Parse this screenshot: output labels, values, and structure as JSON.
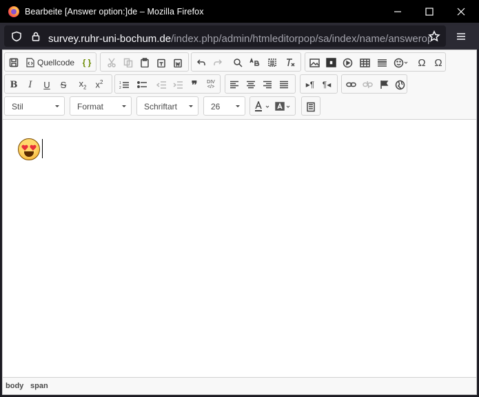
{
  "window": {
    "title": "Bearbeite [Answer option:]de – Mozilla Firefox"
  },
  "url": {
    "host": "survey.ruhr-uni-bochum.de",
    "path": "/index.php/admin/htmleditorpop/sa/index/name/answeroption"
  },
  "toolbar": {
    "source_label": "Quellcode",
    "style_combo": "Stil",
    "format_combo": "Format",
    "font_combo": "Schriftart",
    "size_combo": "26"
  },
  "statusbar": {
    "path": [
      "body",
      "span"
    ]
  },
  "icons": {
    "save": "save-icon",
    "source": "source-icon",
    "template": "template-icon",
    "cut": "cut-icon",
    "copy": "copy-icon",
    "paste": "paste-icon",
    "paste_text": "paste-text-icon",
    "paste_word": "paste-word-icon",
    "undo": "undo-icon",
    "redo": "redo-icon",
    "find": "find-icon",
    "replace": "replace-icon",
    "select_all": "select-all-icon",
    "remove_format": "remove-format-icon",
    "image": "image-icon",
    "flash": "flash-icon",
    "media": "media-icon",
    "table": "table-icon",
    "hr": "horizontal-line-icon",
    "smiley": "smiley-icon",
    "special_char": "omega-icon",
    "bold": "bold-icon",
    "italic": "italic-icon",
    "underline": "underline-icon",
    "strike": "strike-icon",
    "subscript": "subscript-icon",
    "superscript": "superscript-icon",
    "ol": "numbered-list-icon",
    "ul": "bulleted-list-icon",
    "outdent": "outdent-icon",
    "indent": "indent-icon",
    "blockquote": "blockquote-icon",
    "div": "div-icon",
    "link": "link-icon",
    "unlink": "unlink-icon",
    "anchor": "anchor-icon",
    "iframe": "iframe-icon",
    "text_color": "text-color-icon",
    "bg_color": "bg-color-icon",
    "maximize": "maximize-icon"
  },
  "colors": {
    "titlebar": "#000000",
    "navbar": "#2b2a33",
    "toolbar": "#f8f8f8"
  }
}
